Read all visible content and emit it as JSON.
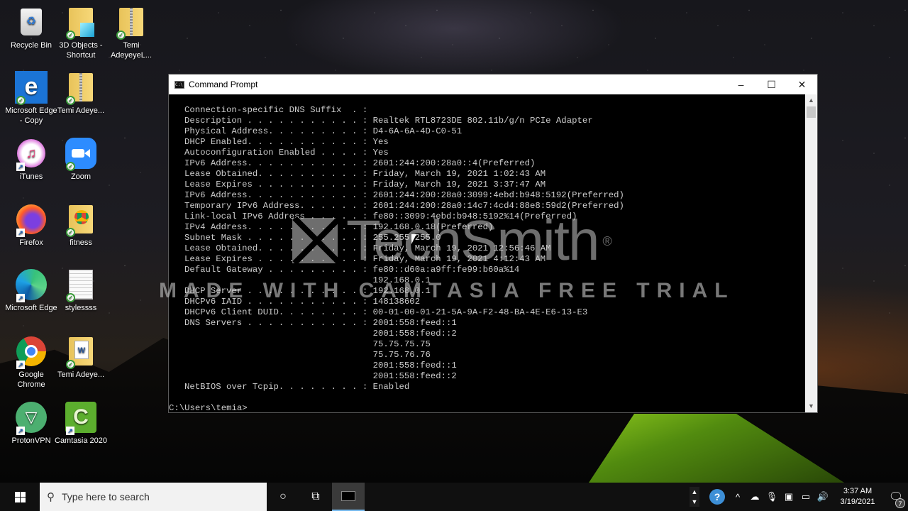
{
  "desktop": {
    "icons": [
      {
        "label": "Recycle Bin",
        "icon": "recycle-bin-icon"
      },
      {
        "label": "3D Objects - Shortcut",
        "icon": "3d-objects-folder-icon"
      },
      {
        "label": "Temi AdeyeyeL...",
        "icon": "zip-folder-icon"
      },
      {
        "label": "Microsoft Edge - Copy",
        "icon": "edge-legacy-icon"
      },
      {
        "label": "Temi Adeye...",
        "icon": "zip-folder-icon"
      },
      {
        "label": "iTunes",
        "icon": "itunes-icon"
      },
      {
        "label": "Zoom",
        "icon": "zoom-icon"
      },
      {
        "label": "Firefox",
        "icon": "firefox-icon"
      },
      {
        "label": "fitness",
        "icon": "chrome-document-folder-icon"
      },
      {
        "label": "Microsoft Edge",
        "icon": "edge-icon"
      },
      {
        "label": "stylessss",
        "icon": "document-icon"
      },
      {
        "label": "Google Chrome",
        "icon": "chrome-icon"
      },
      {
        "label": "Temi Adeye...",
        "icon": "word-document-icon"
      },
      {
        "label": "ProtonVPN",
        "icon": "protonvpn-icon"
      },
      {
        "label": "Camtasia 2020",
        "icon": "camtasia-icon"
      }
    ]
  },
  "window": {
    "title": "Command Prompt",
    "minimize": "–",
    "maximize": "☐",
    "close": "✕"
  },
  "console": {
    "lines": [
      "Connection-specific DNS Suffix  . :",
      "Description . . . . . . . . . . . : Realtek RTL8723DE 802.11b/g/n PCIe Adapter",
      "Physical Address. . . . . . . . . : D4-6A-6A-4D-C0-51",
      "DHCP Enabled. . . . . . . . . . . : Yes",
      "Autoconfiguration Enabled . . . . : Yes",
      "IPv6 Address. . . . . . . . . . . : 2601:244:200:28a0::4(Preferred)",
      "Lease Obtained. . . . . . . . . . : Friday, March 19, 2021 1:02:43 AM",
      "Lease Expires . . . . . . . . . . : Friday, March 19, 2021 3:37:47 AM",
      "IPv6 Address. . . . . . . . . . . : 2601:244:200:28a0:3099:4ebd:b948:5192(Preferred)",
      "Temporary IPv6 Address. . . . . . : 2601:244:200:28a0:14c7:4cd4:88e8:59d2(Preferred)",
      "Link-local IPv6 Address . . . . . : fe80::3099:4ebd:b948:5192%14(Preferred)",
      "IPv4 Address. . . . . . . . . . . : 192.168.0.18(Preferred)",
      "Subnet Mask . . . . . . . . . . . : 255.255.255.0",
      "Lease Obtained. . . . . . . . . . : Friday, March 19, 2021 12:56:46 AM",
      "Lease Expires . . . . . . . . . . : Friday, March 19, 2021 4:12:43 AM",
      "Default Gateway . . . . . . . . . : fe80::d60a:a9ff:fe99:b60a%14",
      "                                    192.168.0.1",
      "DHCP Server . . . . . . . . . . . : 192.168.0.1",
      "DHCPv6 IAID . . . . . . . . . . . : 148138602",
      "DHCPv6 Client DUID. . . . . . . . : 00-01-00-01-21-5A-9A-F2-48-BA-4E-E6-13-E3",
      "DNS Servers . . . . . . . . . . . : 2001:558:feed::1",
      "                                    2001:558:feed::2",
      "                                    75.75.75.75",
      "                                    75.75.76.76",
      "                                    2001:558:feed::1",
      "                                    2001:558:feed::2",
      "NetBIOS over Tcpip. . . . . . . . : Enabled",
      ""
    ],
    "prompt": "C:\\Users\\temia>"
  },
  "watermark": {
    "brand": "TechSmith",
    "registered": "®",
    "banner": "MADE WITH CAMTASIA FREE TRIAL"
  },
  "taskbar": {
    "search_placeholder": "Type here to search",
    "active_app": "Command Prompt",
    "clock_time": "3:37 AM",
    "clock_date": "3/19/2021",
    "notification_count": "7",
    "help_label": "?"
  },
  "colors": {
    "console_bg": "#000000",
    "console_fg": "#cccccc",
    "taskbar_bg": "#101010",
    "accent": "#76b9ed"
  }
}
